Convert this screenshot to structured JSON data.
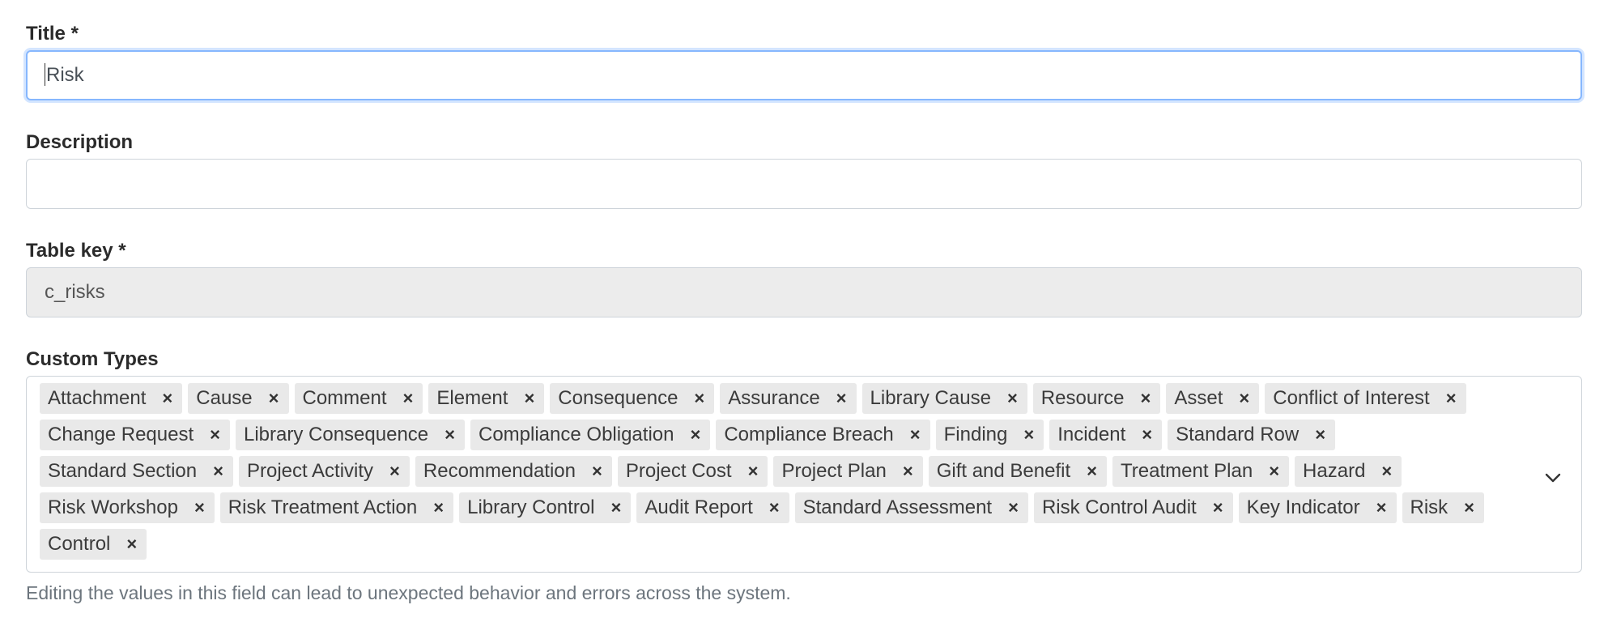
{
  "title_field": {
    "label": "Title *",
    "value": "Risk"
  },
  "description_field": {
    "label": "Description",
    "value": ""
  },
  "table_key_field": {
    "label": "Table key *",
    "value": "c_risks"
  },
  "custom_types": {
    "label": "Custom Types",
    "remove_glyph": "×",
    "tags": [
      "Attachment",
      "Cause",
      "Comment",
      "Element",
      "Consequence",
      "Assurance",
      "Library Cause",
      "Resource",
      "Asset",
      "Conflict of Interest",
      "Change Request",
      "Library Consequence",
      "Compliance Obligation",
      "Compliance Breach",
      "Finding",
      "Incident",
      "Standard Row",
      "Standard Section",
      "Project Activity",
      "Recommendation",
      "Project Cost",
      "Project Plan",
      "Gift and Benefit",
      "Treatment Plan",
      "Hazard",
      "Risk Workshop",
      "Risk Treatment Action",
      "Library Control",
      "Audit Report",
      "Standard Assessment",
      "Risk Control Audit",
      "Key Indicator",
      "Risk",
      "Control"
    ],
    "help_text": "Editing the values in this field can lead to unexpected behavior and errors across the system."
  },
  "colors": {
    "focus_border": "#86b7fe",
    "tag_background": "#e9e9e9",
    "disabled_background": "#ececec",
    "help_text": "#6c757d"
  },
  "icons": {
    "dropdown": "chevron-down-icon",
    "remove": "close-icon"
  }
}
